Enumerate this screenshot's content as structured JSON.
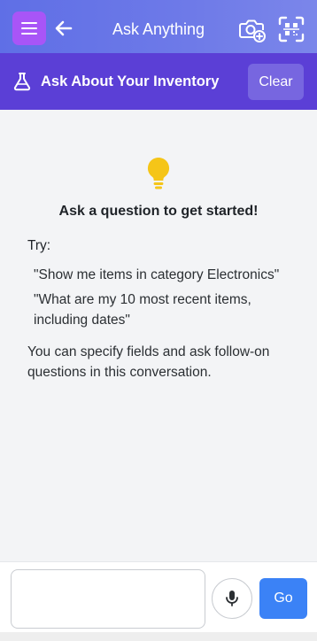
{
  "topbar": {
    "title": "Ask Anything",
    "icons": {
      "menu": "hamburger-icon",
      "back": "arrow-left-icon",
      "camera": "camera-plus-icon",
      "scan": "scan-icon"
    }
  },
  "section": {
    "title": "Ask About Your Inventory",
    "icon": "flask-icon",
    "clear_label": "Clear"
  },
  "empty_state": {
    "icon": "lightbulb-icon",
    "heading": "Ask a question to get started!",
    "try_label": "Try:",
    "examples": [
      "\"Show me items in category Electronics\"",
      "\"What are my 10 most recent items, including dates\""
    ],
    "help_text": "You can specify fields and ask follow-on questions in this conversation."
  },
  "composer": {
    "input_value": "",
    "input_placeholder": "",
    "mic_icon": "microphone-icon",
    "go_label": "Go"
  },
  "colors": {
    "topbar_gradient_start": "#5f6fe6",
    "topbar_gradient_end": "#7b86ea",
    "menu_button": "#a855f7",
    "section_header": "#5b3fd6",
    "clear_button": "#7766e0",
    "bulb": "#f5c518",
    "go_button": "#3b82f6",
    "background": "#f3f4f6"
  }
}
